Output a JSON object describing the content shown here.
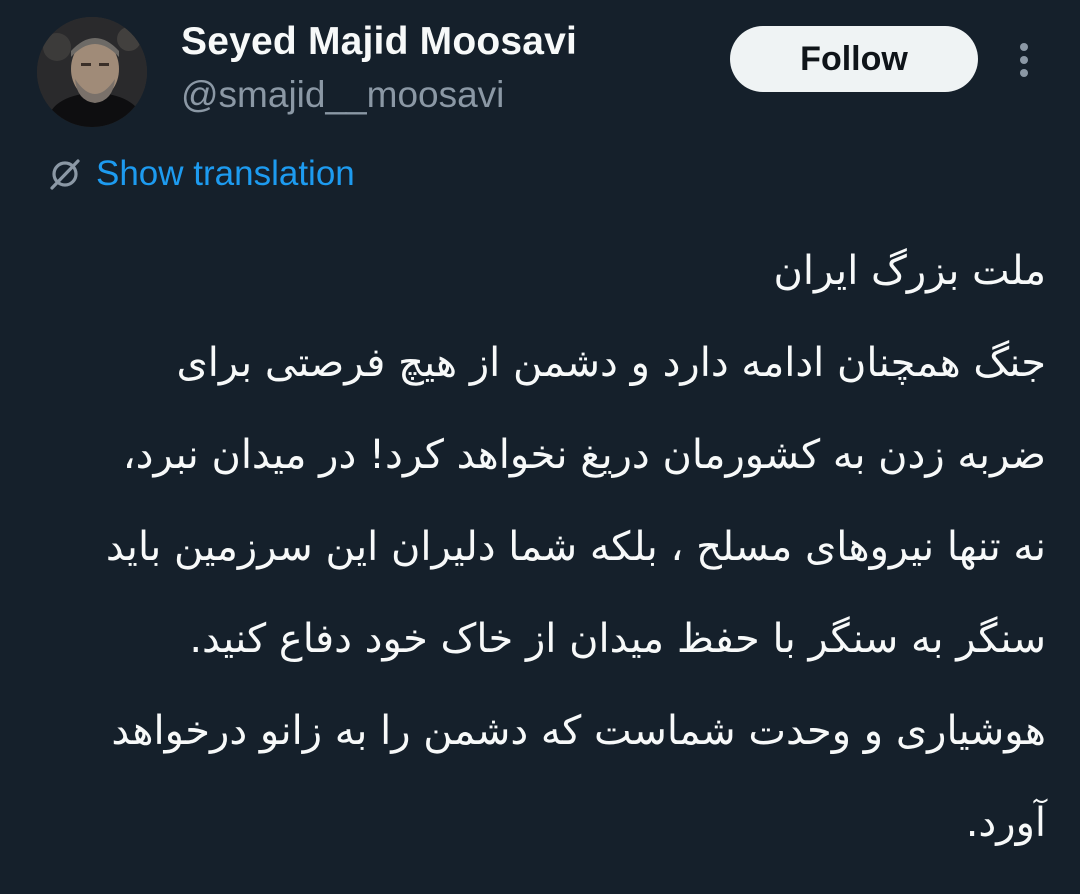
{
  "author": {
    "display_name": "Seyed Majid Moosavi",
    "handle": "@smajid__moosavi",
    "avatar_icon": "profile-photo"
  },
  "actions": {
    "follow_label": "Follow",
    "more_icon": "vertical-ellipsis-icon"
  },
  "translation": {
    "label": "Show translation",
    "icon": "translate-globe-icon",
    "color": "#1d9bf0"
  },
  "tweet": {
    "lines": [
      "ملت بزرگ ایران",
      "جنگ همچنان ادامه دارد و دشمن از هیچ فرصتی برای",
      "ضربه زدن به کشورمان دریغ نخواهد کرد! در میدان نبرد،",
      "نه تنها نیروهای مسلح ، بلکه شما دلیران این سرزمین باید",
      "سنگر به سنگر با حفظ میدان از خاک خود دفاع کنید.",
      "هوشیاری و وحدت شماست که دشمن را به زانو درخواهد",
      "آورد."
    ]
  },
  "theme": {
    "background": "#15202b",
    "text": "#f7f9f9",
    "secondary_text": "#8b98a5"
  }
}
